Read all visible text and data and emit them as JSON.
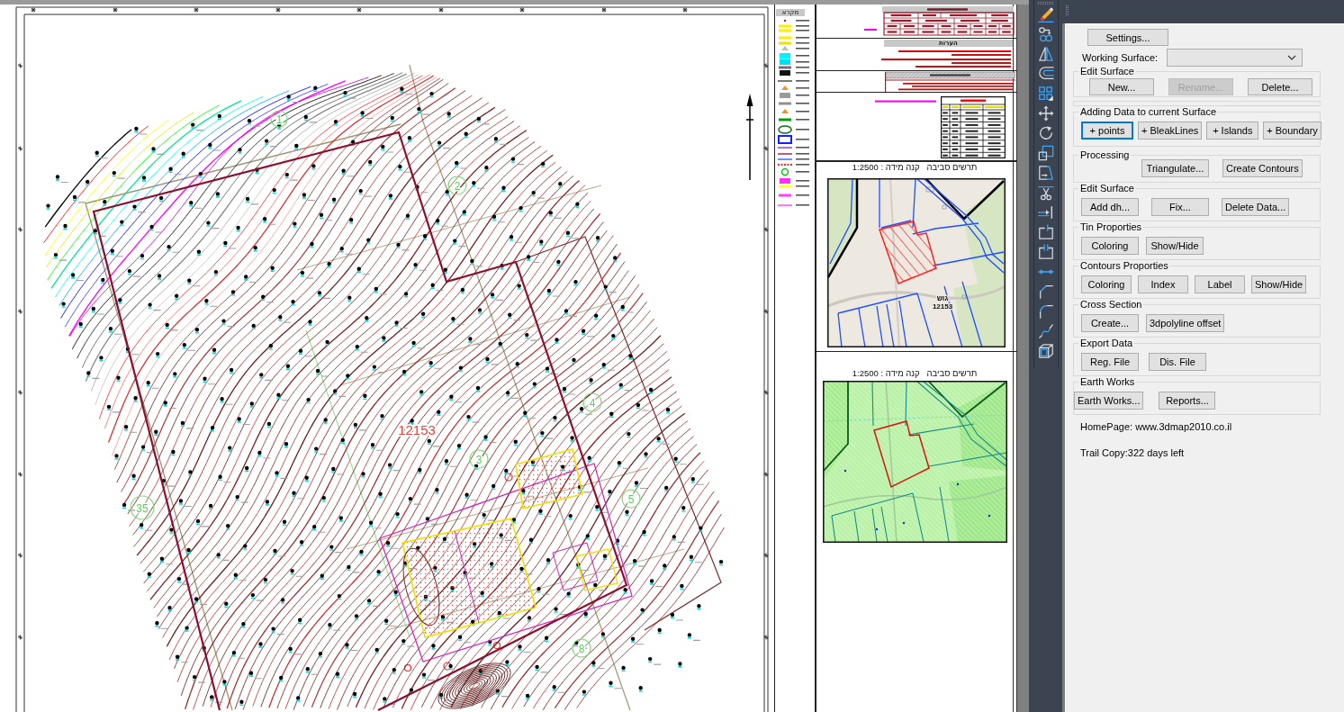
{
  "sheet": {
    "site_plan": {
      "parcel_number": "12153",
      "plot_markers": [
        {
          "label": "1"
        },
        {
          "label": "2"
        },
        {
          "label": "4"
        },
        {
          "label": "3"
        },
        {
          "label": "5"
        },
        {
          "label": "35"
        },
        {
          "label": "8"
        }
      ]
    },
    "legend": {
      "title": "מקרא"
    },
    "title_block": {
      "notes_title": "הערות",
      "maps": [
        {
          "kind": "street",
          "title": "תרשים סביבה   קנה מידה : 1:2500",
          "labels": [
            "גוש",
            "12153"
          ]
        },
        {
          "kind": "zoning",
          "title": "תרשים סביבה   קנה מידה : 1:2500"
        }
      ]
    }
  },
  "panel": {
    "settings_button": "Settings...",
    "working_surface": {
      "label": "Working Surface:"
    },
    "groups": [
      {
        "kind": "buttons",
        "title": "Edit Surface",
        "buttons": [
          {
            "label": "New...",
            "disabled": false,
            "focused": false
          },
          {
            "label": "Rename...",
            "disabled": true,
            "focused": false
          },
          {
            "label": "Delete...",
            "disabled": false,
            "focused": false
          }
        ]
      },
      {
        "kind": "empty"
      },
      {
        "kind": "buttons",
        "title": "Adding Data to current Surface",
        "buttons": [
          {
            "label": "+ points",
            "disabled": false,
            "focused": true
          },
          {
            "label": "+ BleakLines",
            "disabled": false,
            "focused": false
          },
          {
            "label": "+ Islands",
            "disabled": false,
            "focused": false
          },
          {
            "label": "+ Boundary",
            "disabled": false,
            "focused": false
          }
        ]
      },
      {
        "kind": "buttons",
        "title": "Processing",
        "buttons": [
          {
            "label": "Triangulate...",
            "disabled": false,
            "focused": false
          },
          {
            "label": "Create Contours",
            "disabled": false,
            "focused": false
          }
        ]
      },
      {
        "kind": "buttons",
        "title": "Edit Surface",
        "buttons": [
          {
            "label": "Add dh...",
            "disabled": false,
            "focused": false
          },
          {
            "label": "Fix...",
            "disabled": false,
            "focused": false
          },
          {
            "label": "Delete Data...",
            "disabled": false,
            "focused": false
          }
        ]
      },
      {
        "kind": "buttons",
        "title": "Tin Proporties",
        "buttons": [
          {
            "label": "Coloring",
            "disabled": false,
            "focused": false
          },
          {
            "label": "Show/Hide",
            "disabled": false,
            "focused": false
          }
        ]
      },
      {
        "kind": "buttons",
        "title": "Contours Proporties",
        "buttons": [
          {
            "label": "Coloring",
            "disabled": false,
            "focused": false
          },
          {
            "label": "Index",
            "disabled": false,
            "focused": false
          },
          {
            "label": "Label",
            "disabled": false,
            "focused": false
          },
          {
            "label": "Show/Hide",
            "disabled": false,
            "focused": false
          }
        ]
      },
      {
        "kind": "buttons",
        "title": "Cross Section",
        "buttons": [
          {
            "label": "Create...",
            "disabled": false,
            "focused": false
          },
          {
            "label": "3dpolyline offset",
            "disabled": false,
            "focused": false
          }
        ]
      },
      {
        "kind": "buttons",
        "title": "Export Data",
        "buttons": [
          {
            "label": "Reg. File",
            "disabled": false,
            "focused": false
          },
          {
            "label": "Dis. File",
            "disabled": false,
            "focused": false
          }
        ]
      },
      {
        "kind": "buttons",
        "title": "Earth Works",
        "buttons": [
          {
            "label": "Earth Works...",
            "disabled": false,
            "focused": false
          },
          {
            "label": "Reports...",
            "disabled": false,
            "focused": false
          }
        ]
      }
    ],
    "homepage": "HomePage: www.3dmap2010.co.il",
    "trial_note": "Trail Copy:322 days left"
  }
}
